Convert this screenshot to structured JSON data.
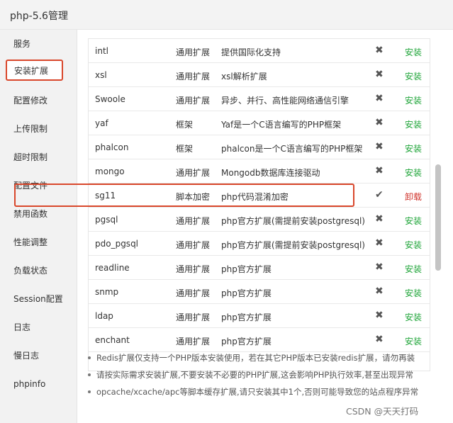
{
  "window": {
    "title": "php-5.6管理"
  },
  "sidebar": {
    "items": [
      {
        "label": "服务"
      },
      {
        "label": "安装扩展"
      },
      {
        "label": "配置修改"
      },
      {
        "label": "上传限制"
      },
      {
        "label": "超时限制"
      },
      {
        "label": "配置文件"
      },
      {
        "label": "禁用函数"
      },
      {
        "label": "性能调整"
      },
      {
        "label": "负载状态"
      },
      {
        "label": "Session配置"
      },
      {
        "label": "日志"
      },
      {
        "label": "慢日志"
      },
      {
        "label": "phpinfo"
      }
    ],
    "active_item": "安装扩展"
  },
  "extensions": {
    "rows": [
      {
        "name": "intl",
        "type": "通用扩展",
        "desc": "提供国际化支持",
        "status": "✖",
        "action": "安装"
      },
      {
        "name": "xsl",
        "type": "通用扩展",
        "desc": "xsl解析扩展",
        "status": "✖",
        "action": "安装"
      },
      {
        "name": "Swoole",
        "type": "通用扩展",
        "desc": "异步、并行、高性能网络通信引擎",
        "status": "✖",
        "action": "安装"
      },
      {
        "name": "yaf",
        "type": "框架",
        "desc": "Yaf是一个C语言编写的PHP框架",
        "status": "✖",
        "action": "安装"
      },
      {
        "name": "phalcon",
        "type": "框架",
        "desc": "phalcon是一个C语言编写的PHP框架",
        "status": "✖",
        "action": "安装"
      },
      {
        "name": "mongo",
        "type": "通用扩展",
        "desc": "Mongodb数据库连接驱动",
        "status": "✖",
        "action": "安装"
      },
      {
        "name": "sg11",
        "type": "脚本加密",
        "desc": "php代码混淆加密",
        "status": "✔",
        "action": "卸载"
      },
      {
        "name": "pgsql",
        "type": "通用扩展",
        "desc": "php官方扩展(需提前安装postgresql)",
        "status": "✖",
        "action": "安装"
      },
      {
        "name": "pdo_pgsql",
        "type": "通用扩展",
        "desc": "php官方扩展(需提前安装postgresql)",
        "status": "✖",
        "action": "安装"
      },
      {
        "name": "readline",
        "type": "通用扩展",
        "desc": "php官方扩展",
        "status": "✖",
        "action": "安装"
      },
      {
        "name": "snmp",
        "type": "通用扩展",
        "desc": "php官方扩展",
        "status": "✖",
        "action": "安装"
      },
      {
        "name": "ldap",
        "type": "通用扩展",
        "desc": "php官方扩展",
        "status": "✖",
        "action": "安装"
      },
      {
        "name": "enchant",
        "type": "通用扩展",
        "desc": "php官方扩展",
        "status": "✖",
        "action": "安装"
      }
    ],
    "colors": {
      "install": "#20a53a",
      "uninstall": "#d0342c",
      "highlight": "#d9472b"
    }
  },
  "notes": [
    "Redis扩展仅支持一个PHP版本安装使用，若在其它PHP版本已安装redis扩展，请勿再装",
    "请按实际需求安装扩展,不要安装不必要的PHP扩展,这会影响PHP执行效率,甚至出现异常",
    "opcache/xcache/apc等脚本缓存扩展,请只安装其中1个,否则可能导致您的站点程序异常"
  ],
  "watermark": "CSDN @天天打码"
}
